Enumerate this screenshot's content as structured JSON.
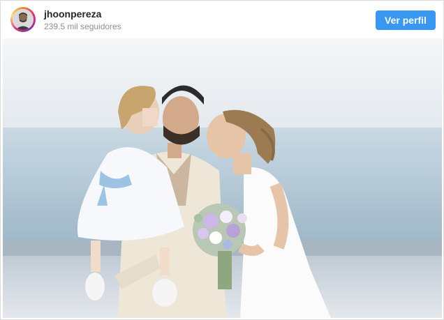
{
  "post": {
    "username": "jhoonpereza",
    "followers": "239.5 mil seguidores",
    "profile_button": "Ver perfil"
  },
  "icons": {
    "avatar": "avatar-icon",
    "photo": "wedding-family-photo"
  },
  "colors": {
    "accent": "#3897f0",
    "username": "#262626",
    "secondary_text": "#8e8e8e"
  }
}
